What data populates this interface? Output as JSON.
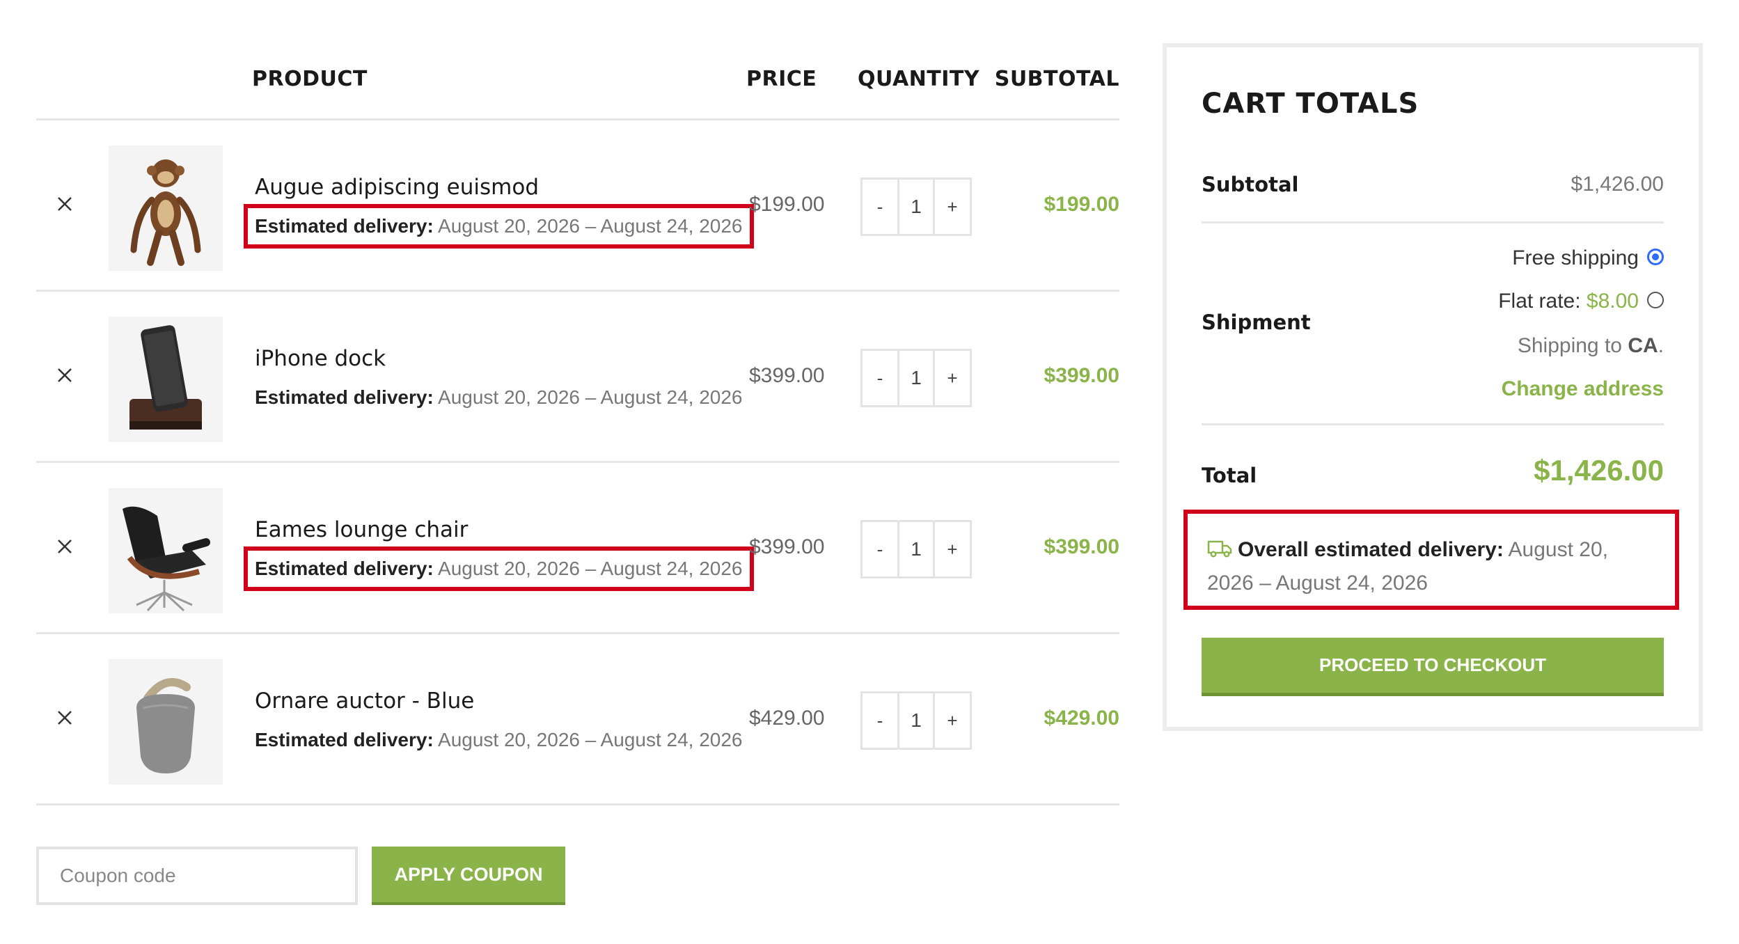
{
  "table": {
    "headers": {
      "product": "PRODUCT",
      "price": "PRICE",
      "quantity": "QUANTITY",
      "subtotal": "SUBTOTAL"
    },
    "delivery_label": "Estimated delivery:",
    "items": [
      {
        "name": "Augue adipiscing euismod",
        "delivery": "August 20, 2026 – August 24, 2026",
        "price": "$199.00",
        "qty": "1",
        "subtotal": "$199.00",
        "highlighted": true,
        "image": "wooden-monkey"
      },
      {
        "name": "iPhone dock",
        "delivery": "August 20, 2026 – August 24, 2026",
        "price": "$399.00",
        "qty": "1",
        "subtotal": "$399.00",
        "highlighted": false,
        "image": "phone-dock"
      },
      {
        "name": "Eames lounge chair",
        "delivery": "August 20, 2026 – August 24, 2026",
        "price": "$399.00",
        "qty": "1",
        "subtotal": "$399.00",
        "highlighted": true,
        "image": "lounge-chair"
      },
      {
        "name": "Ornare auctor - Blue",
        "delivery": "August 20, 2026 – August 24, 2026",
        "price": "$429.00",
        "qty": "1",
        "subtotal": "$429.00",
        "highlighted": false,
        "image": "speaker"
      }
    ],
    "qty_minus": "-",
    "qty_plus": "+"
  },
  "coupon": {
    "placeholder": "Coupon code",
    "button": "APPLY COUPON"
  },
  "totals": {
    "title": "CART TOTALS",
    "subtotal_label": "Subtotal",
    "subtotal_value": "$1,426.00",
    "shipment_label": "Shipment",
    "free_shipping": "Free shipping",
    "flat_rate_label": "Flat rate:",
    "flat_rate_value": "$8.00",
    "shipping_to_prefix": "Shipping to",
    "shipping_to_region": "CA",
    "shipping_to_suffix": ".",
    "change_address": "Change address",
    "total_label": "Total",
    "total_value": "$1,426.00",
    "overall_label": "Overall estimated delivery:",
    "overall_value": "August 20, 2026 – August 24, 2026",
    "checkout": "PROCEED TO CHECKOUT"
  },
  "colors": {
    "accent": "#8ab44a",
    "highlight": "#d0021b",
    "radio": "#2f6bff"
  }
}
